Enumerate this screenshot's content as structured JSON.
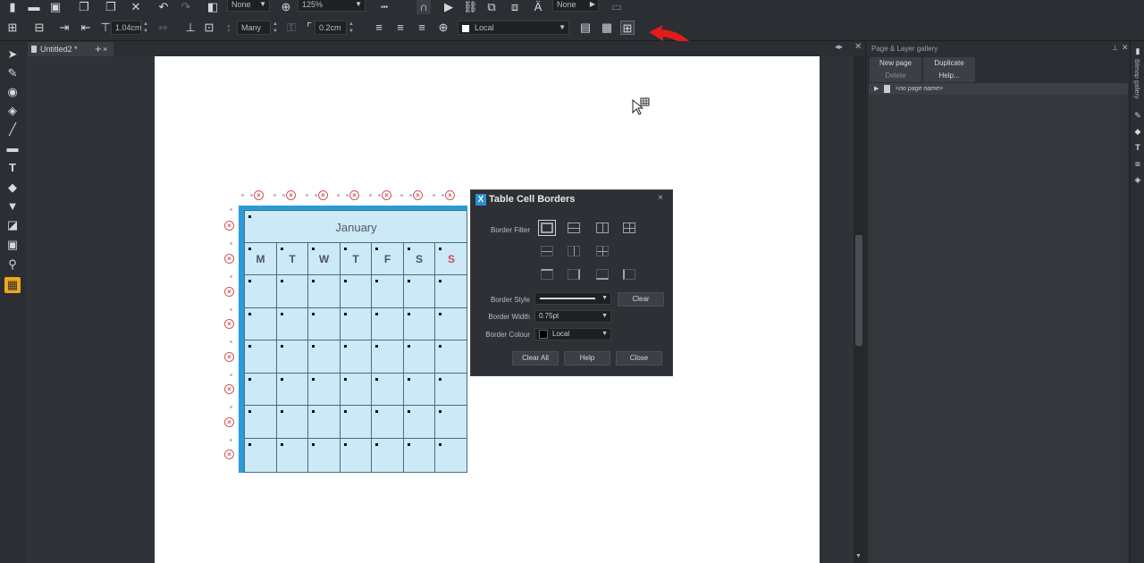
{
  "toolbar": {
    "quality_combo": "None",
    "zoom_combo": "125%",
    "right_combo": "None",
    "width_value": "1.04cm",
    "gap_combo": "Many",
    "rotate_value": "0.2cm",
    "local_combo": "Local"
  },
  "document": {
    "tab_label": "Untitled2 *",
    "new_tab": "+"
  },
  "calendar": {
    "month": "January",
    "days": [
      "M",
      "T",
      "W",
      "T",
      "F",
      "S",
      "S"
    ]
  },
  "dialog": {
    "title": "Table Cell Borders",
    "logo": "X",
    "close": "×",
    "border_filter_label": "Border Filter",
    "border_style_label": "Border Style",
    "border_width_label": "Border Width",
    "border_width_value": "0.75pt",
    "border_colour_label": "Border Colour",
    "border_colour_value": "Local",
    "clear_label": "Clear",
    "clear_all_label": "Clear All",
    "help_label": "Help",
    "close_label": "Close"
  },
  "right_panel": {
    "title": "Page & Layer gallery",
    "new_page": "New page",
    "duplicate": "Duplicate",
    "delete": "Delete",
    "help": "Help...",
    "page_item": "<no page name>",
    "side_label": "Bitmap gallery"
  },
  "colors": {
    "accent_active_tool": "#f0a818",
    "table_fill": "#cbe9f7",
    "table_selection": "#2a9bd8",
    "annotation_arrow": "#e11b1b",
    "sunday": "#d0464f"
  }
}
